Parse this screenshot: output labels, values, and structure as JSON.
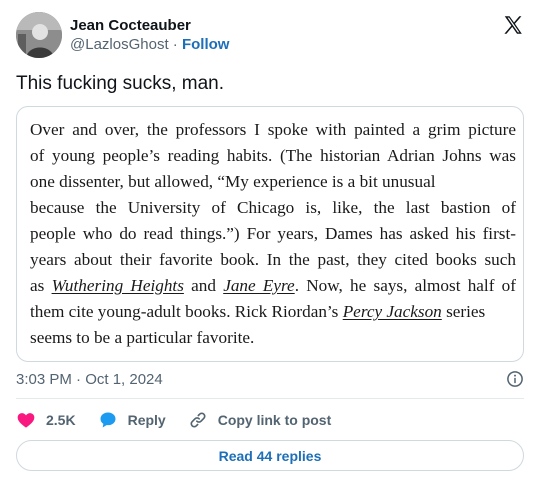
{
  "author": {
    "display_name": "Jean Cocteauber",
    "handle": "@LazlosGhost",
    "separator": " · ",
    "follow_label": "Follow"
  },
  "post": {
    "text": "This fucking sucks, man."
  },
  "excerpt": {
    "lines": [
      "Over and over, the professors I spoke with painted a grim picture",
      "of young people’s reading habits. (The historian Adrian Johns was",
      "one dissenter, but allowed, “My experience is a bit unusual",
      "because the University of Chicago is, like, the last bastion of",
      "people who do read things.”) For years, Dames has asked his first-",
      "years about their favorite book. In the past, they cited books such"
    ],
    "line7_pre": "as ",
    "book_1": "Wuthering Heights",
    "line7_mid": " and ",
    "book_2": "Jane Eyre",
    "line7_post": ". Now, he says, almost half of",
    "line8_pre": "them cite young-adult books. Rick Riordan’s ",
    "book_3": "Percy Jackson",
    "line8_post": " series",
    "line9": "seems to be a particular favorite."
  },
  "timestamp": "3:03 PM · Oct 1, 2024",
  "actions": {
    "like_count": "2.5K",
    "reply_label": "Reply",
    "copy_label": "Copy link to post"
  },
  "read_replies_label": "Read 44 replies",
  "icons": {
    "like": "heart-icon",
    "reply": "speech-bubble-icon",
    "copy": "link-icon",
    "info": "info-icon",
    "brand": "x-logo-icon"
  },
  "colors": {
    "heart": "#f91880",
    "reply_bubble": "#1d9bf0",
    "link_text": "#1d6fb8",
    "muted_text": "#536471"
  }
}
